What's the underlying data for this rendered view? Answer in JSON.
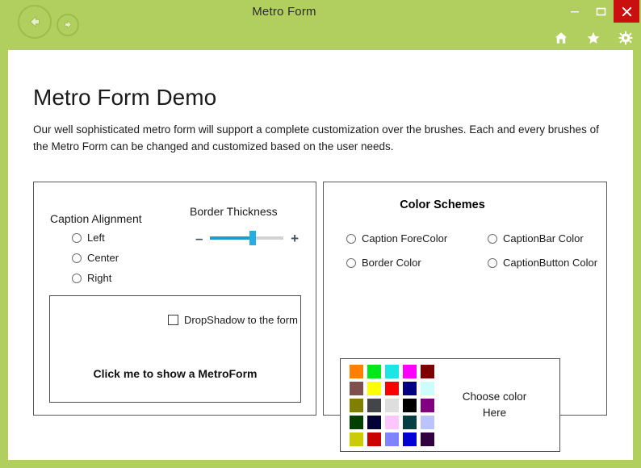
{
  "window": {
    "title": "Metro Form",
    "accent_color": "#b1cf5e",
    "close_button_color": "#c9100f",
    "nav": {
      "back_icon": "arrow-left-icon",
      "forward_icon": "arrow-right-icon"
    },
    "system_buttons": [
      {
        "name": "minimize-button",
        "glyph": "–"
      },
      {
        "name": "maximize-button",
        "glyph": "□"
      },
      {
        "name": "close-button",
        "glyph": "✕"
      }
    ],
    "tool_icons": [
      {
        "name": "home-icon",
        "label": "Home"
      },
      {
        "name": "star-icon",
        "label": "Favorites"
      },
      {
        "name": "gear-icon",
        "label": "Settings"
      }
    ]
  },
  "page": {
    "title": "Metro Form Demo",
    "description": "Our well sophisticated metro form will support a complete customization over the brushes. Each and every brushes of the Metro Form can be changed and customized based on the user needs."
  },
  "left_panel": {
    "caption_alignment_label": "Caption Alignment",
    "alignment_options": [
      {
        "label": "Left",
        "selected": false
      },
      {
        "label": "Center",
        "selected": false
      },
      {
        "label": "Right",
        "selected": false
      }
    ],
    "border_thickness_label": "Border Thickness",
    "slider": {
      "minus": "–",
      "plus": "+",
      "value_percent": 58,
      "fill_color": "#1e9bd7",
      "thumb_color": "#29ace3",
      "track_color": "#d2d2d2"
    },
    "dropshadow_checkbox": {
      "label": "DropShadow to the form",
      "checked": false
    },
    "metroform_button_label": "Click me to show a MetroForm"
  },
  "right_panel": {
    "title": "Color Schemes",
    "scheme_options": [
      {
        "label": "Caption ForeColor",
        "selected": false
      },
      {
        "label": "CaptionBar Color",
        "selected": false
      },
      {
        "label": "Border Color",
        "selected": false
      },
      {
        "label": "CaptionButton Color",
        "selected": false
      }
    ],
    "choose_color_line1": "Choose color",
    "choose_color_line2": "Here",
    "palette": [
      "#ff8000",
      "#00e81a",
      "#1ce5e5",
      "#ff00ff",
      "#7d0000",
      "#80504e",
      "#ffff00",
      "#fe0000",
      "#020080",
      "#ccfcfc",
      "#807f01",
      "#444546",
      "#dededf",
      "#000000",
      "#800080",
      "#004000",
      "#030236",
      "#ffc6fe",
      "#063f41",
      "#bcc2fb",
      "#cbcb07",
      "#ca0202",
      "#7f84fd",
      "#0201d3",
      "#33003f"
    ]
  }
}
